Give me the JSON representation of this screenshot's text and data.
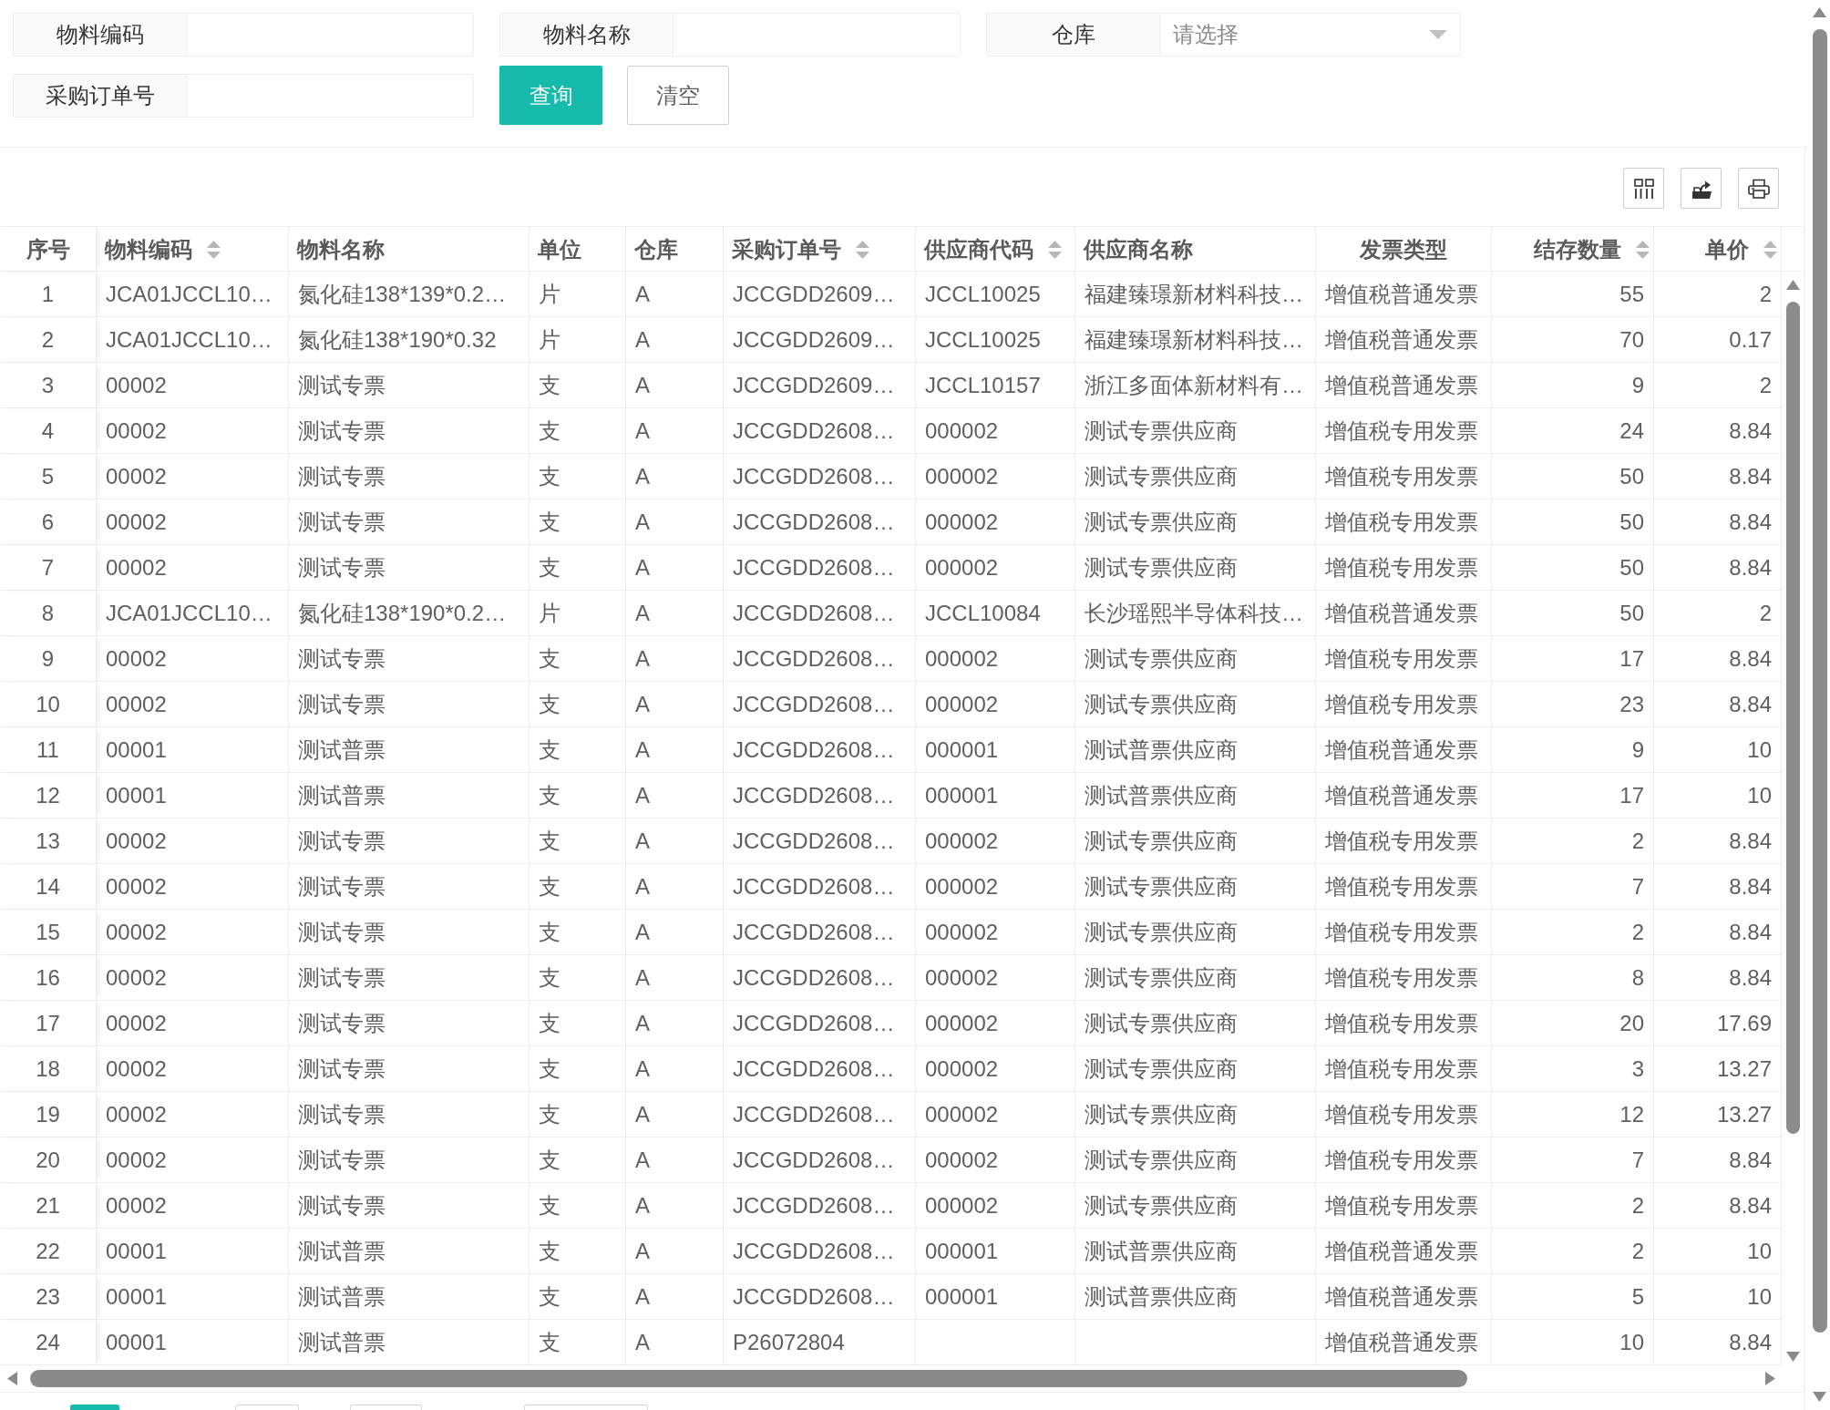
{
  "search_form": {
    "fields": [
      {
        "label": "物料编码",
        "kind": "text"
      },
      {
        "label": "物料名称",
        "kind": "text"
      },
      {
        "label": "仓库",
        "kind": "select",
        "placeholder": "请选择"
      },
      {
        "label": "采购订单号",
        "kind": "text"
      }
    ],
    "buttons": [
      {
        "label": "查询",
        "kind": "primary"
      },
      {
        "label": "清空",
        "kind": "default"
      }
    ]
  },
  "table": {
    "columns": [
      {
        "title": "序号",
        "sortable": false
      },
      {
        "title": "物料编码",
        "sortable": true
      },
      {
        "title": "物料名称",
        "sortable": false
      },
      {
        "title": "单位",
        "sortable": false
      },
      {
        "title": "仓库",
        "sortable": false
      },
      {
        "title": "采购订单号",
        "sortable": true
      },
      {
        "title": "供应商代码",
        "sortable": true
      },
      {
        "title": "供应商名称",
        "sortable": false
      },
      {
        "title": "发票类型",
        "sortable": false
      },
      {
        "title": "结存数量",
        "sortable": true
      },
      {
        "title": "单价",
        "sortable": true
      }
    ],
    "rows": [
      {
        "no": "1",
        "material_code": "JCA01JCCL10…",
        "material_name": "氮化硅138*139*0.2…",
        "unit": "片",
        "warehouse": "A",
        "po_number": "JCCGDD2609…",
        "supplier_code": "JCCL10025",
        "supplier_name": "福建臻璟新材料科技…",
        "invoice_type": "增值税普通发票",
        "stock_qty": "55",
        "unit_price": "2"
      },
      {
        "no": "2",
        "material_code": "JCA01JCCL10…",
        "material_name": "氮化硅138*190*0.32",
        "unit": "片",
        "warehouse": "A",
        "po_number": "JCCGDD2609…",
        "supplier_code": "JCCL10025",
        "supplier_name": "福建臻璟新材料科技…",
        "invoice_type": "增值税普通发票",
        "stock_qty": "70",
        "unit_price": "0.17"
      },
      {
        "no": "3",
        "material_code": "00002",
        "material_name": "测试专票",
        "unit": "支",
        "warehouse": "A",
        "po_number": "JCCGDD2609…",
        "supplier_code": "JCCL10157",
        "supplier_name": "浙江多面体新材料有…",
        "invoice_type": "增值税普通发票",
        "stock_qty": "9",
        "unit_price": "2"
      },
      {
        "no": "4",
        "material_code": "00002",
        "material_name": "测试专票",
        "unit": "支",
        "warehouse": "A",
        "po_number": "JCCGDD2608…",
        "supplier_code": "000002",
        "supplier_name": "测试专票供应商",
        "invoice_type": "增值税专用发票",
        "stock_qty": "24",
        "unit_price": "8.84"
      },
      {
        "no": "5",
        "material_code": "00002",
        "material_name": "测试专票",
        "unit": "支",
        "warehouse": "A",
        "po_number": "JCCGDD2608…",
        "supplier_code": "000002",
        "supplier_name": "测试专票供应商",
        "invoice_type": "增值税专用发票",
        "stock_qty": "50",
        "unit_price": "8.84"
      },
      {
        "no": "6",
        "material_code": "00002",
        "material_name": "测试专票",
        "unit": "支",
        "warehouse": "A",
        "po_number": "JCCGDD2608…",
        "supplier_code": "000002",
        "supplier_name": "测试专票供应商",
        "invoice_type": "增值税专用发票",
        "stock_qty": "50",
        "unit_price": "8.84"
      },
      {
        "no": "7",
        "material_code": "00002",
        "material_name": "测试专票",
        "unit": "支",
        "warehouse": "A",
        "po_number": "JCCGDD2608…",
        "supplier_code": "000002",
        "supplier_name": "测试专票供应商",
        "invoice_type": "增值税专用发票",
        "stock_qty": "50",
        "unit_price": "8.84"
      },
      {
        "no": "8",
        "material_code": "JCA01JCCL10…",
        "material_name": "氮化硅138*190*0.2…",
        "unit": "片",
        "warehouse": "A",
        "po_number": "JCCGDD2608…",
        "supplier_code": "JCCL10084",
        "supplier_name": "长沙瑶熙半导体科技…",
        "invoice_type": "增值税普通发票",
        "stock_qty": "50",
        "unit_price": "2"
      },
      {
        "no": "9",
        "material_code": "00002",
        "material_name": "测试专票",
        "unit": "支",
        "warehouse": "A",
        "po_number": "JCCGDD2608…",
        "supplier_code": "000002",
        "supplier_name": "测试专票供应商",
        "invoice_type": "增值税专用发票",
        "stock_qty": "17",
        "unit_price": "8.84"
      },
      {
        "no": "10",
        "material_code": "00002",
        "material_name": "测试专票",
        "unit": "支",
        "warehouse": "A",
        "po_number": "JCCGDD2608…",
        "supplier_code": "000002",
        "supplier_name": "测试专票供应商",
        "invoice_type": "增值税专用发票",
        "stock_qty": "23",
        "unit_price": "8.84"
      },
      {
        "no": "11",
        "material_code": "00001",
        "material_name": "测试普票",
        "unit": "支",
        "warehouse": "A",
        "po_number": "JCCGDD2608…",
        "supplier_code": "000001",
        "supplier_name": "测试普票供应商",
        "invoice_type": "增值税普通发票",
        "stock_qty": "9",
        "unit_price": "10"
      },
      {
        "no": "12",
        "material_code": "00001",
        "material_name": "测试普票",
        "unit": "支",
        "warehouse": "A",
        "po_number": "JCCGDD2608…",
        "supplier_code": "000001",
        "supplier_name": "测试普票供应商",
        "invoice_type": "增值税普通发票",
        "stock_qty": "17",
        "unit_price": "10"
      },
      {
        "no": "13",
        "material_code": "00002",
        "material_name": "测试专票",
        "unit": "支",
        "warehouse": "A",
        "po_number": "JCCGDD2608…",
        "supplier_code": "000002",
        "supplier_name": "测试专票供应商",
        "invoice_type": "增值税专用发票",
        "stock_qty": "2",
        "unit_price": "8.84"
      },
      {
        "no": "14",
        "material_code": "00002",
        "material_name": "测试专票",
        "unit": "支",
        "warehouse": "A",
        "po_number": "JCCGDD2608…",
        "supplier_code": "000002",
        "supplier_name": "测试专票供应商",
        "invoice_type": "增值税专用发票",
        "stock_qty": "7",
        "unit_price": "8.84"
      },
      {
        "no": "15",
        "material_code": "00002",
        "material_name": "测试专票",
        "unit": "支",
        "warehouse": "A",
        "po_number": "JCCGDD2608…",
        "supplier_code": "000002",
        "supplier_name": "测试专票供应商",
        "invoice_type": "增值税专用发票",
        "stock_qty": "2",
        "unit_price": "8.84"
      },
      {
        "no": "16",
        "material_code": "00002",
        "material_name": "测试专票",
        "unit": "支",
        "warehouse": "A",
        "po_number": "JCCGDD2608…",
        "supplier_code": "000002",
        "supplier_name": "测试专票供应商",
        "invoice_type": "增值税专用发票",
        "stock_qty": "8",
        "unit_price": "8.84"
      },
      {
        "no": "17",
        "material_code": "00002",
        "material_name": "测试专票",
        "unit": "支",
        "warehouse": "A",
        "po_number": "JCCGDD2608…",
        "supplier_code": "000002",
        "supplier_name": "测试专票供应商",
        "invoice_type": "增值税专用发票",
        "stock_qty": "20",
        "unit_price": "17.69"
      },
      {
        "no": "18",
        "material_code": "00002",
        "material_name": "测试专票",
        "unit": "支",
        "warehouse": "A",
        "po_number": "JCCGDD2608…",
        "supplier_code": "000002",
        "supplier_name": "测试专票供应商",
        "invoice_type": "增值税专用发票",
        "stock_qty": "3",
        "unit_price": "13.27"
      },
      {
        "no": "19",
        "material_code": "00002",
        "material_name": "测试专票",
        "unit": "支",
        "warehouse": "A",
        "po_number": "JCCGDD2608…",
        "supplier_code": "000002",
        "supplier_name": "测试专票供应商",
        "invoice_type": "增值税专用发票",
        "stock_qty": "12",
        "unit_price": "13.27"
      },
      {
        "no": "20",
        "material_code": "00002",
        "material_name": "测试专票",
        "unit": "支",
        "warehouse": "A",
        "po_number": "JCCGDD2608…",
        "supplier_code": "000002",
        "supplier_name": "测试专票供应商",
        "invoice_type": "增值税专用发票",
        "stock_qty": "7",
        "unit_price": "8.84"
      },
      {
        "no": "21",
        "material_code": "00002",
        "material_name": "测试专票",
        "unit": "支",
        "warehouse": "A",
        "po_number": "JCCGDD2608…",
        "supplier_code": "000002",
        "supplier_name": "测试专票供应商",
        "invoice_type": "增值税专用发票",
        "stock_qty": "2",
        "unit_price": "8.84"
      },
      {
        "no": "22",
        "material_code": "00001",
        "material_name": "测试普票",
        "unit": "支",
        "warehouse": "A",
        "po_number": "JCCGDD2608…",
        "supplier_code": "000001",
        "supplier_name": "测试普票供应商",
        "invoice_type": "增值税普通发票",
        "stock_qty": "2",
        "unit_price": "10"
      },
      {
        "no": "23",
        "material_code": "00001",
        "material_name": "测试普票",
        "unit": "支",
        "warehouse": "A",
        "po_number": "JCCGDD2608…",
        "supplier_code": "000001",
        "supplier_name": "测试普票供应商",
        "invoice_type": "增值税普通发票",
        "stock_qty": "5",
        "unit_price": "10"
      },
      {
        "no": "24",
        "material_code": "00001",
        "material_name": "测试普票",
        "unit": "支",
        "warehouse": "A",
        "po_number": "P26072804",
        "invoice_type": "增值税普通发票",
        "stock_qty": "10",
        "unit_price": "8.84"
      }
    ]
  },
  "pager": [
    {
      "selected": true
    },
    {
      "selected": false
    },
    {
      "selected": false
    },
    {
      "selected": false
    }
  ]
}
